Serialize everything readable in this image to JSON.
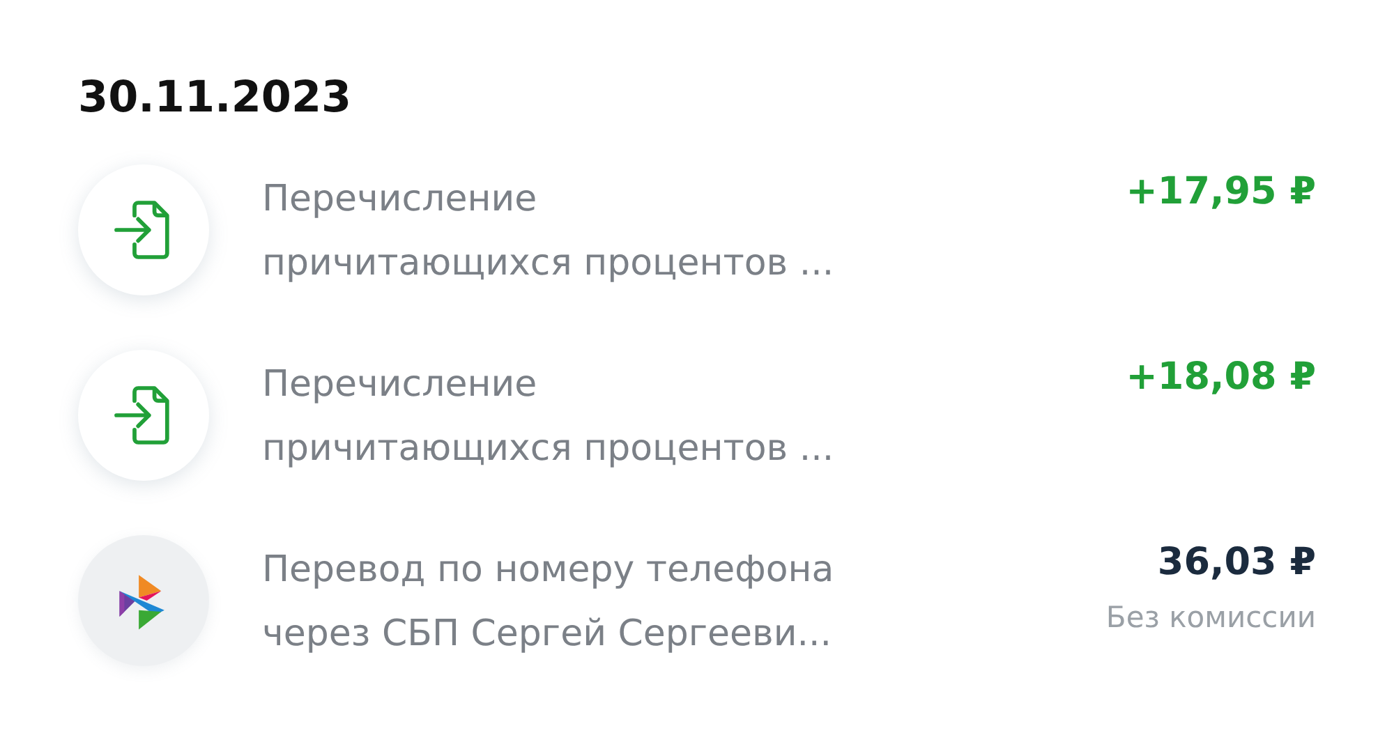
{
  "date": "30.11.2023",
  "operations": [
    {
      "kind": "income",
      "title": "Перечисление",
      "subtitle": "причитающихся процентов ...",
      "amount": "+17,95 ₽"
    },
    {
      "kind": "income",
      "title": "Перечисление",
      "subtitle": "причитающихся процентов ...",
      "amount": "+18,08 ₽"
    },
    {
      "kind": "transfer",
      "title": "Перевод по номеру телефона",
      "subtitle": "через СБП Сергей Сергееви...",
      "amount": "36,03 ₽",
      "note": "Без комиссии"
    }
  ]
}
